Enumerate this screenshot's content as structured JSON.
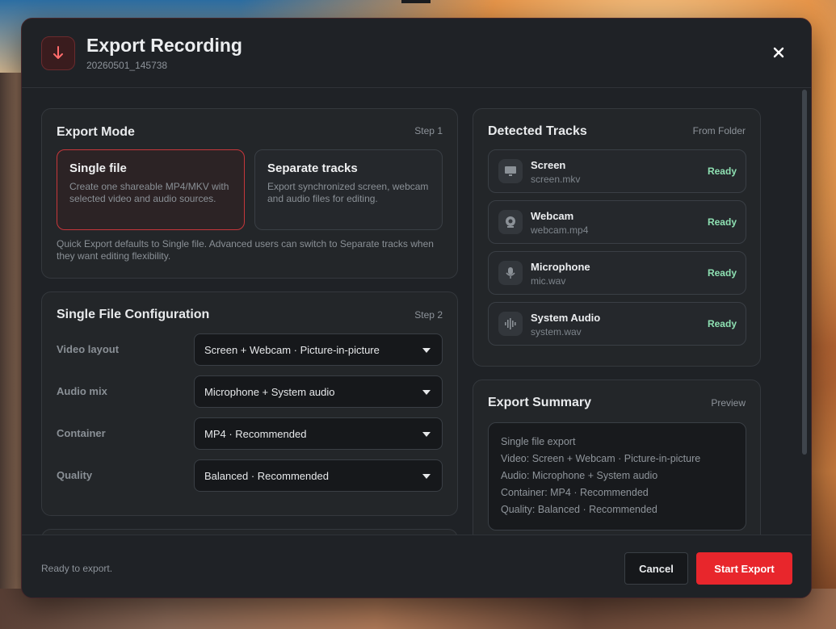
{
  "header": {
    "title": "Export Recording",
    "subtitle": "20260501_145738",
    "icon": "download-arrow-icon",
    "close_icon": "close-icon"
  },
  "export_mode": {
    "title": "Export Mode",
    "step": "Step 1",
    "options": [
      {
        "title": "Single file",
        "desc": "Create one shareable MP4/MKV with selected video and audio sources.",
        "selected": true
      },
      {
        "title": "Separate tracks",
        "desc": "Export synchronized screen, webcam and audio files for editing.",
        "selected": false
      }
    ],
    "note": "Quick Export defaults to Single file. Advanced users can switch to Separate tracks when they want editing flexibility."
  },
  "single_config": {
    "title": "Single File Configuration",
    "step": "Step 2",
    "rows": [
      {
        "label": "Video layout",
        "value": "Screen + Webcam · Picture-in-picture"
      },
      {
        "label": "Audio mix",
        "value": "Microphone + System audio"
      },
      {
        "label": "Container",
        "value": "MP4 · Recommended"
      },
      {
        "label": "Quality",
        "value": "Balanced · Recommended"
      }
    ]
  },
  "detected_tracks": {
    "title": "Detected Tracks",
    "source": "From Folder",
    "tracks": [
      {
        "name": "Screen",
        "file": "screen.mkv",
        "status": "Ready",
        "icon": "monitor-icon"
      },
      {
        "name": "Webcam",
        "file": "webcam.mp4",
        "status": "Ready",
        "icon": "webcam-icon"
      },
      {
        "name": "Microphone",
        "file": "mic.wav",
        "status": "Ready",
        "icon": "microphone-icon"
      },
      {
        "name": "System Audio",
        "file": "system.wav",
        "status": "Ready",
        "icon": "waveform-icon"
      }
    ]
  },
  "summary": {
    "title": "Export Summary",
    "tag": "Preview",
    "lines": [
      "Single file export",
      "Video: Screen + Webcam · Picture-in-picture",
      "Audio: Microphone + System audio",
      "Container: MP4 · Recommended",
      "Quality: Balanced · Recommended"
    ]
  },
  "footer": {
    "status": "Ready to export.",
    "cancel_label": "Cancel",
    "start_label": "Start Export"
  },
  "colors": {
    "accent": "#e8262c",
    "ready": "#8ee0b2",
    "panel": "#1f2226"
  }
}
